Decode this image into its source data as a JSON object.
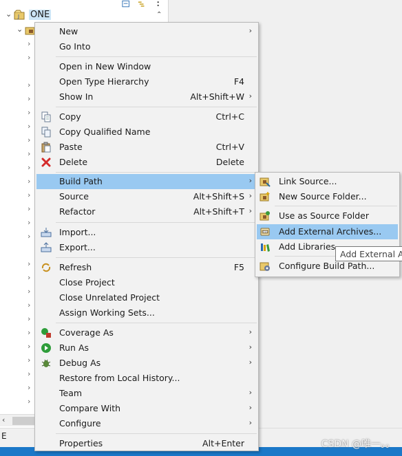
{
  "explorer": {
    "project_name": "ONE",
    "status_text": "E"
  },
  "watermark": "CSDN @唯一。。",
  "context_menu": {
    "items": [
      {
        "label": "New",
        "accel": "",
        "submenu": true
      },
      {
        "label": "Go Into",
        "accel": "",
        "submenu": false
      },
      {
        "label": "Open in New Window",
        "accel": "",
        "submenu": false
      },
      {
        "label": "Open Type Hierarchy",
        "accel": "F4",
        "submenu": false
      },
      {
        "label": "Show In",
        "accel": "Alt+Shift+W",
        "submenu": true
      },
      {
        "label": "Copy",
        "accel": "Ctrl+C",
        "submenu": false,
        "icon": "copy-icon"
      },
      {
        "label": "Copy Qualified Name",
        "accel": "",
        "submenu": false,
        "icon": "copy-qualified-icon"
      },
      {
        "label": "Paste",
        "accel": "Ctrl+V",
        "submenu": false,
        "icon": "paste-icon"
      },
      {
        "label": "Delete",
        "accel": "Delete",
        "submenu": false,
        "icon": "delete-icon"
      },
      {
        "label": "Build Path",
        "accel": "",
        "submenu": true,
        "highlighted": true
      },
      {
        "label": "Source",
        "accel": "Alt+Shift+S",
        "submenu": true
      },
      {
        "label": "Refactor",
        "accel": "Alt+Shift+T",
        "submenu": true
      },
      {
        "label": "Import...",
        "accel": "",
        "submenu": false,
        "icon": "import-icon"
      },
      {
        "label": "Export...",
        "accel": "",
        "submenu": false,
        "icon": "export-icon"
      },
      {
        "label": "Refresh",
        "accel": "F5",
        "submenu": false,
        "icon": "refresh-icon"
      },
      {
        "label": "Close Project",
        "accel": "",
        "submenu": false
      },
      {
        "label": "Close Unrelated Project",
        "accel": "",
        "submenu": false
      },
      {
        "label": "Assign Working Sets...",
        "accel": "",
        "submenu": false
      },
      {
        "label": "Coverage As",
        "accel": "",
        "submenu": true,
        "icon": "coverage-icon"
      },
      {
        "label": "Run As",
        "accel": "",
        "submenu": true,
        "icon": "run-icon"
      },
      {
        "label": "Debug As",
        "accel": "",
        "submenu": true,
        "icon": "debug-icon"
      },
      {
        "label": "Restore from Local History...",
        "accel": "",
        "submenu": false
      },
      {
        "label": "Team",
        "accel": "",
        "submenu": true
      },
      {
        "label": "Compare With",
        "accel": "",
        "submenu": true
      },
      {
        "label": "Configure",
        "accel": "",
        "submenu": true
      },
      {
        "label": "Properties",
        "accel": "Alt+Enter",
        "submenu": false
      }
    ]
  },
  "build_path_submenu": {
    "items": [
      {
        "label": "Link Source...",
        "icon": "link-source-icon"
      },
      {
        "label": "New Source Folder...",
        "icon": "new-source-folder-icon"
      },
      {
        "label": "Use as Source Folder",
        "icon": "use-source-folder-icon"
      },
      {
        "label": "Add External Archives...",
        "icon": "jar-icon",
        "highlighted": true
      },
      {
        "label": "Add Libraries...",
        "icon": "library-icon"
      },
      {
        "label": "Configure Build Path...",
        "icon": "configure-build-path-icon"
      }
    ]
  },
  "tooltip": {
    "text": "Add External Archives..."
  },
  "colors": {
    "highlight": "#99c9f1",
    "taskbar": "#1b78c8"
  }
}
